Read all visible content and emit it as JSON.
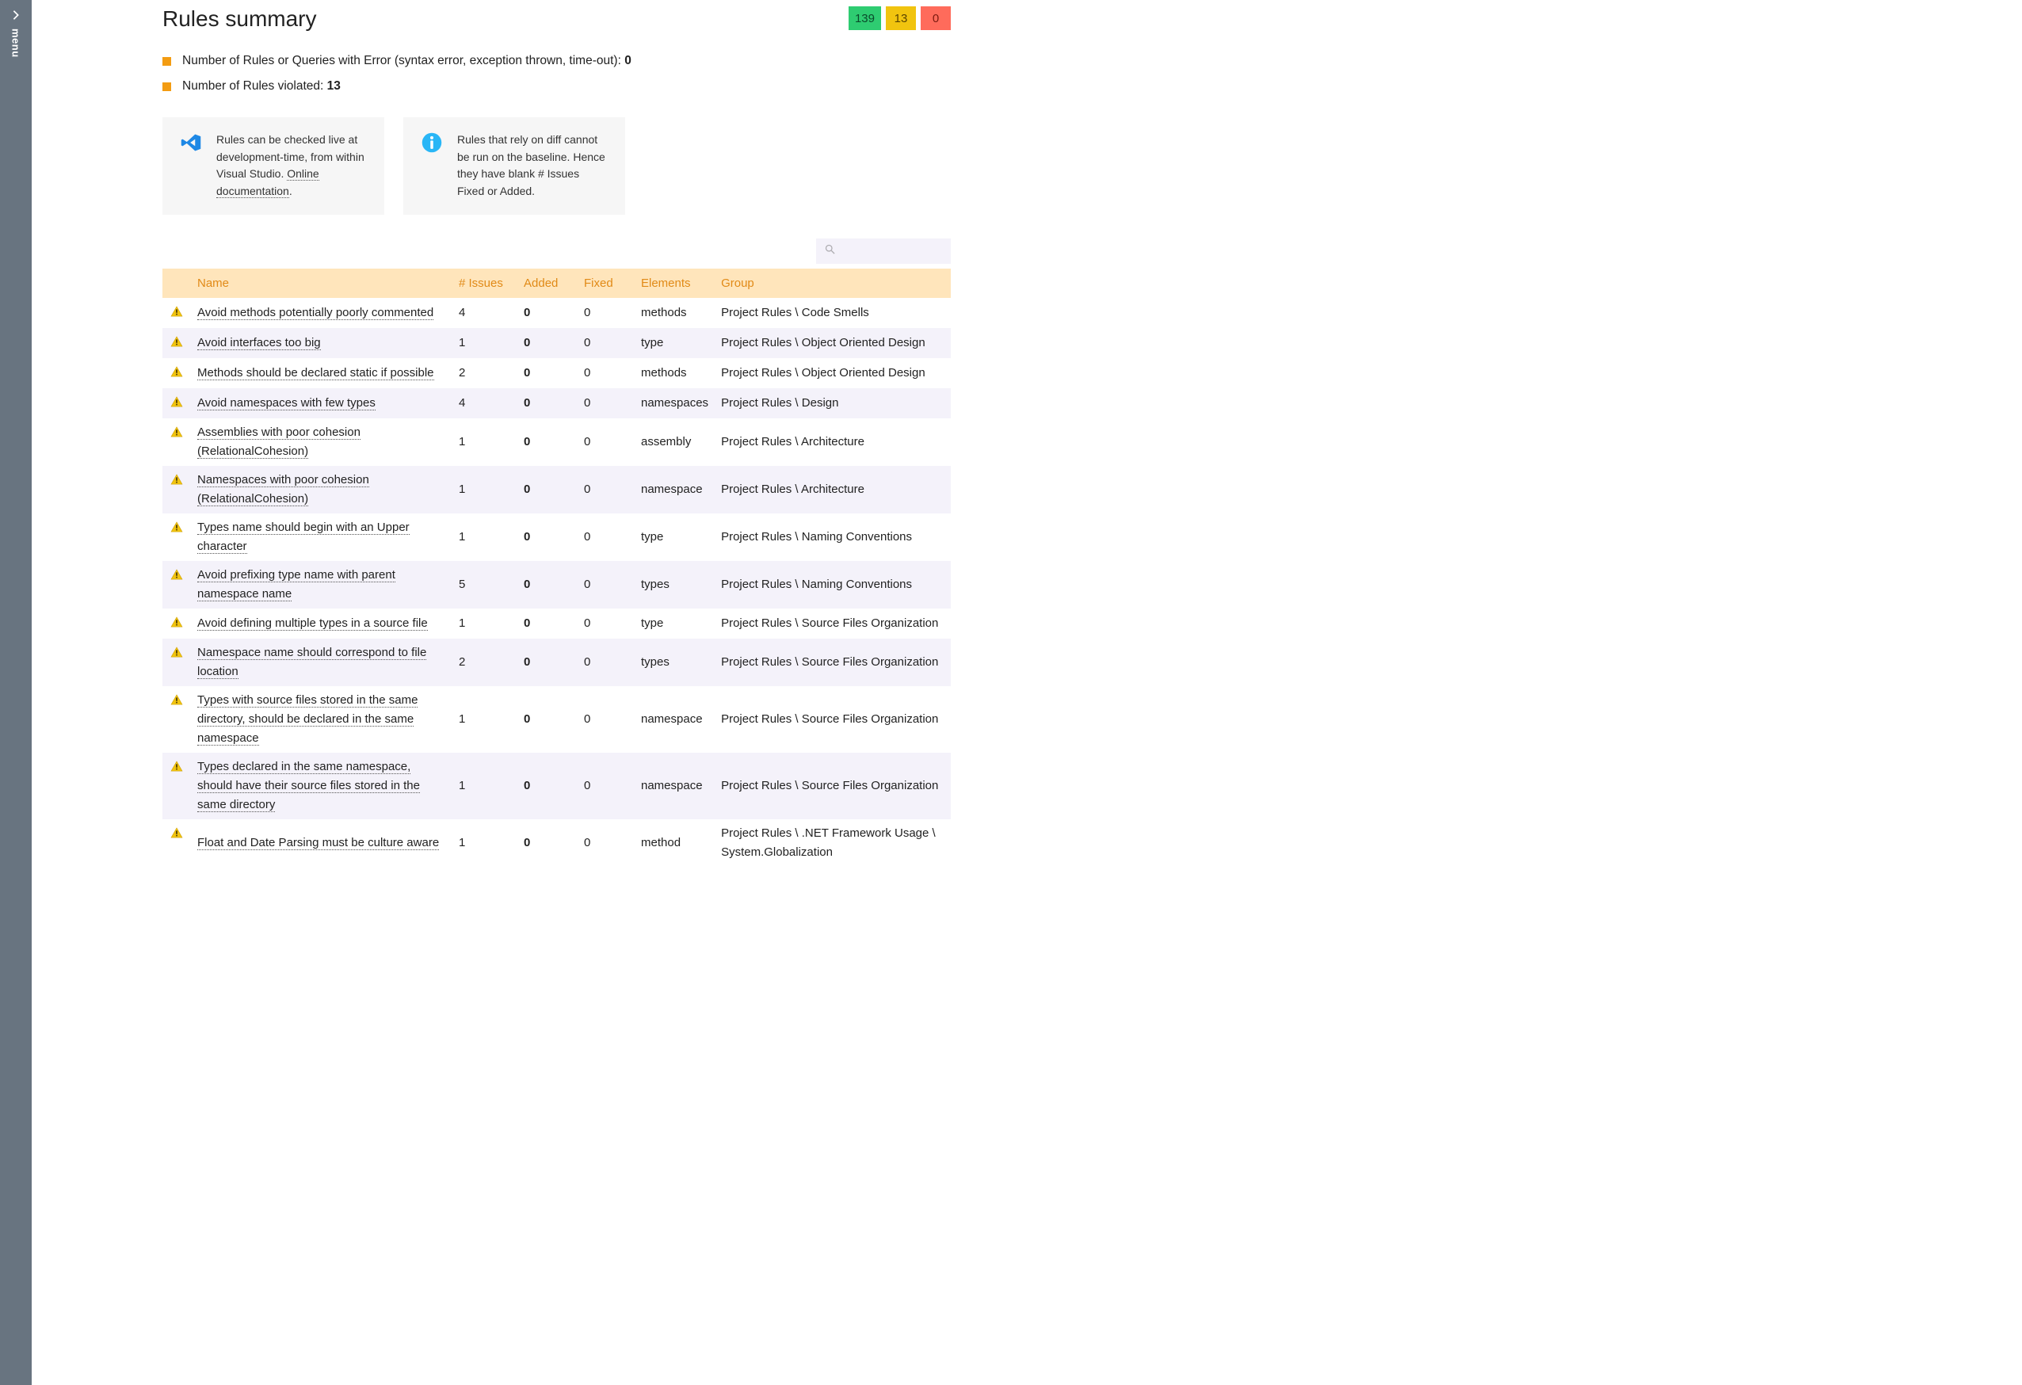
{
  "sidebar": {
    "menu_label": "menu"
  },
  "header": {
    "title": "Rules summary",
    "badges": {
      "green": "139",
      "yellow": "13",
      "red": "0"
    }
  },
  "summary": {
    "error_line_prefix": "Number of Rules or Queries with Error (syntax error, exception thrown, time-out): ",
    "error_count": "0",
    "violated_prefix": "Number of Rules violated: ",
    "violated_count": "13"
  },
  "infobox1": {
    "text_a": "Rules can be checked live at development-time, from within Visual Studio. ",
    "link": "Online documentation"
  },
  "infobox2": {
    "text": "Rules that rely on diff cannot be run on the baseline. Hence they have blank # Issues Fixed or Added."
  },
  "search": {
    "placeholder": ""
  },
  "table": {
    "headers": {
      "name": "Name",
      "issues": "# Issues",
      "added": "Added",
      "fixed": "Fixed",
      "elements": "Elements",
      "group": "Group"
    },
    "rows": [
      {
        "name": "Avoid methods potentially poorly commented",
        "issues": "4",
        "added": "0",
        "fixed": "0",
        "elements": "methods",
        "group": "Project Rules \\ Code Smells"
      },
      {
        "name": "Avoid interfaces too big",
        "issues": "1",
        "added": "0",
        "fixed": "0",
        "elements": "type",
        "group": "Project Rules \\ Object Oriented Design"
      },
      {
        "name": "Methods should be declared static if possible",
        "issues": "2",
        "added": "0",
        "fixed": "0",
        "elements": "methods",
        "group": "Project Rules \\ Object Oriented Design"
      },
      {
        "name": "Avoid namespaces with few types",
        "issues": "4",
        "added": "0",
        "fixed": "0",
        "elements": "namespaces",
        "group": "Project Rules \\ Design"
      },
      {
        "name": "Assemblies with poor cohesion (RelationalCohesion)",
        "issues": "1",
        "added": "0",
        "fixed": "0",
        "elements": "assembly",
        "group": "Project Rules \\ Architecture"
      },
      {
        "name": "Namespaces with poor cohesion (RelationalCohesion)",
        "issues": "1",
        "added": "0",
        "fixed": "0",
        "elements": "namespace",
        "group": "Project Rules \\ Architecture"
      },
      {
        "name": "Types name should begin with an Upper character",
        "issues": "1",
        "added": "0",
        "fixed": "0",
        "elements": "type",
        "group": "Project Rules \\ Naming Conventions"
      },
      {
        "name": "Avoid prefixing type name with parent namespace name",
        "issues": "5",
        "added": "0",
        "fixed": "0",
        "elements": "types",
        "group": "Project Rules \\ Naming Conventions"
      },
      {
        "name": "Avoid defining multiple types in a source file",
        "issues": "1",
        "added": "0",
        "fixed": "0",
        "elements": "type",
        "group": "Project Rules \\ Source Files Organization"
      },
      {
        "name": "Namespace name should correspond to file location",
        "issues": "2",
        "added": "0",
        "fixed": "0",
        "elements": "types",
        "group": "Project Rules \\ Source Files Organization"
      },
      {
        "name": "Types with source files stored in the same directory, should be declared in the same namespace",
        "issues": "1",
        "added": "0",
        "fixed": "0",
        "elements": "namespace",
        "group": "Project Rules \\ Source Files Organization"
      },
      {
        "name": "Types declared in the same namespace, should have their source files stored in the same directory",
        "issues": "1",
        "added": "0",
        "fixed": "0",
        "elements": "namespace",
        "group": "Project Rules \\ Source Files Organization"
      },
      {
        "name": "Float and Date Parsing must be culture aware",
        "issues": "1",
        "added": "0",
        "fixed": "0",
        "elements": "method",
        "group": "Project Rules \\ .NET Framework Usage \\ System.Globalization"
      }
    ]
  }
}
